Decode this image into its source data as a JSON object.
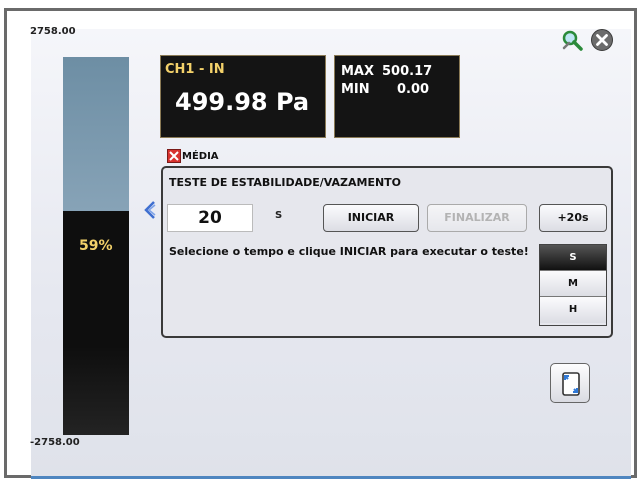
{
  "scale": {
    "max": "2758.00",
    "min": "-2758.00",
    "percent_label": "59%",
    "level_fraction": 0.59
  },
  "channel": {
    "label": "CH1 - IN",
    "value": "499.98 Pa"
  },
  "stats": {
    "max_label": "MAX",
    "max_value": "500.17",
    "min_label": "MIN",
    "min_value": "0.00"
  },
  "media": {
    "label": "MÉDIA",
    "checked": false
  },
  "test": {
    "title": "TESTE DE ESTABILIDADE/VAZAMENTO",
    "time_value": "20",
    "time_unit": "S",
    "start_label": "INICIAR",
    "finish_label": "FINALIZAR",
    "add_label": "+20s",
    "instruction": "Selecione o tempo e clique INICIAR para executar o teste!",
    "units": [
      "S",
      "M",
      "H"
    ],
    "selected_unit": "S"
  },
  "icons": {
    "tool": "magnifier-wrench-icon",
    "close": "close-icon",
    "rotate": "rotate-screen-icon",
    "marker": "level-pointer-icon"
  },
  "colors": {
    "value_gold": "#f3d16a",
    "panel_bg": "#141414",
    "bar_upper": "#7a98ad",
    "accent_blue": "#4f86c0"
  }
}
